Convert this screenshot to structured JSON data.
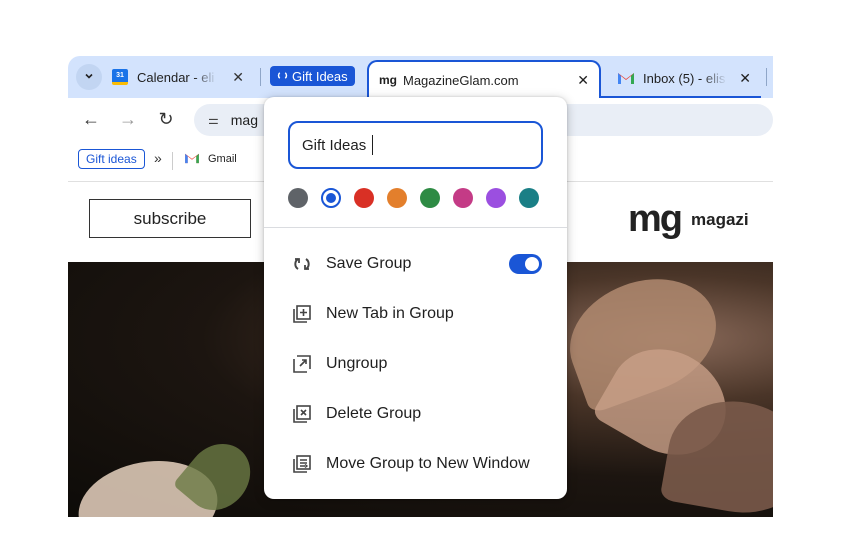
{
  "tabs": {
    "calendar": {
      "title": "Calendar - eli",
      "favicon_text": "31"
    },
    "group_chip": {
      "label": "Gift Ideas"
    },
    "active": {
      "title": "MagazineGlam.com",
      "favicon_text": "mg"
    },
    "inbox": {
      "title": "Inbox (5) - elis"
    },
    "close_glyph": "✕",
    "search_glyph": "⌄"
  },
  "toolbar": {
    "back": "←",
    "forward": "→",
    "reload": "↻",
    "omnibox_text": "mag",
    "tune_glyph": "⚌"
  },
  "bookmarks": {
    "group_chip": "Gift ideas",
    "more": "»",
    "gmail": "Gmail"
  },
  "site": {
    "subscribe": "subscribe",
    "logo_mark": "mg",
    "logo_name": "magazi"
  },
  "tab_group_editor": {
    "name_value": "Gift Ideas",
    "colors": [
      "#5f6368",
      "#1a56d6",
      "#d93025",
      "#e37f2c",
      "#2e8b44",
      "#c43b86",
      "#9b4fe0",
      "#1a7f86"
    ],
    "selected_color_index": 1,
    "save_group": {
      "label": "Save Group",
      "enabled": true
    },
    "menu": [
      {
        "label": "New Tab in Group",
        "icon": "new-tab-in-group-icon"
      },
      {
        "label": "Ungroup",
        "icon": "ungroup-icon"
      },
      {
        "label": "Delete Group",
        "icon": "delete-group-icon"
      },
      {
        "label": "Move Group to New Window",
        "icon": "move-group-icon"
      }
    ]
  }
}
